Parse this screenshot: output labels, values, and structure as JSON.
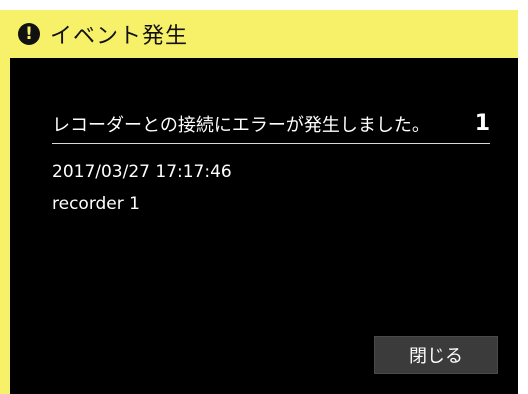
{
  "window": {
    "title": "イベント発生",
    "accent_color": "#f7f16a",
    "icon": "exclamation-icon"
  },
  "event": {
    "message": "レコーダーとの接続にエラーが発生しました。",
    "count": "1",
    "timestamp": "2017/03/27 17:17:46",
    "device": "recorder 1"
  },
  "actions": {
    "close_label": "閉じる"
  }
}
